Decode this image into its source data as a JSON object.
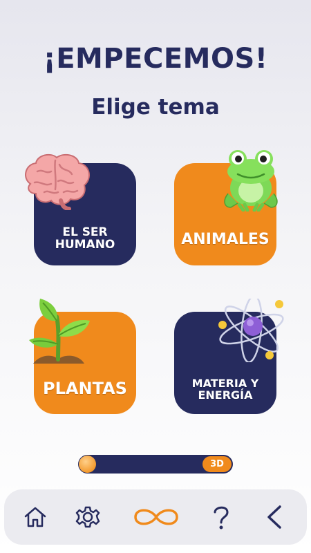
{
  "header": {
    "title": "¡EMPECEMOS!",
    "subtitle": "Elige tema"
  },
  "topics": [
    {
      "line1": "EL SER",
      "line2": "HUMANO",
      "illustration": "brain-icon",
      "color": "#262b5e"
    },
    {
      "line1": "ANIMALES",
      "line2": "",
      "illustration": "frog-icon",
      "color": "#f08a1c"
    },
    {
      "line1": "PLANTAS",
      "line2": "",
      "illustration": "plant-icon",
      "color": "#f08a1c"
    },
    {
      "line1": "MATERIA Y",
      "line2": "ENERGÍA",
      "illustration": "atom-icon",
      "color": "#262b5e"
    }
  ],
  "mode_toggle": {
    "badge": "3D"
  },
  "nav": {
    "items": [
      "home-icon",
      "settings-icon",
      "infinity-icon",
      "help-icon",
      "back-icon"
    ]
  },
  "colors": {
    "navy": "#262b5e",
    "orange": "#f08a1c",
    "background": "#f3f3f6"
  }
}
